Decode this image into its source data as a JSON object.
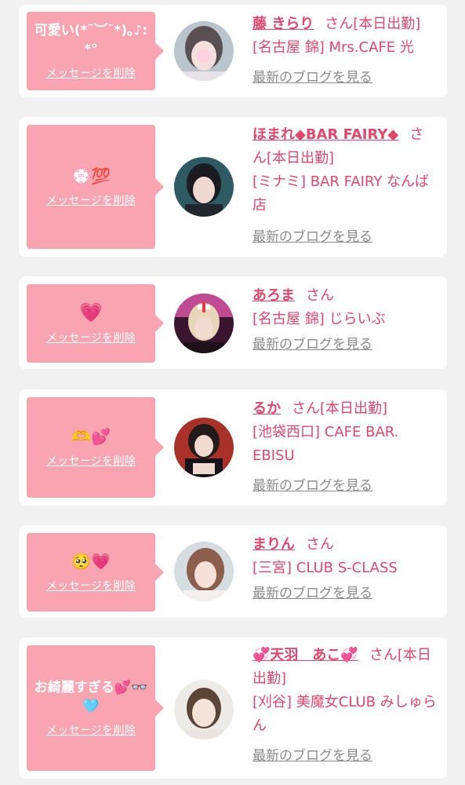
{
  "common": {
    "delete_label": "メッセージを削除",
    "blog_label": "最新のブログを見る"
  },
  "colors": {
    "background": "#f1f1f1",
    "bubble": "#f9a4b1",
    "accent": "#e0476e",
    "link_gray": "#8a8a8a"
  },
  "cards": [
    {
      "message": "可愛い(*¯︶¯*)｡♪:*°",
      "name": "藤 きらり",
      "honorific": "さん",
      "status": "[本日出勤]",
      "shop": "[名古屋 錦] Mrs.CAFE 光"
    },
    {
      "message": "💮💯",
      "name": "ほまれ◆BAR FAIRY◆",
      "honorific": "さん",
      "status": "[本日出勤]",
      "shop": "[ミナミ] BAR FAIRY なんば店"
    },
    {
      "message": "💗",
      "name": "あろま",
      "honorific": "さん",
      "status": "",
      "shop": "[名古屋 錦] じらいぶ"
    },
    {
      "message": "🫶💕",
      "name": "るか",
      "honorific": "さん",
      "status": "[本日出勤]",
      "shop": "[池袋西口] CAFE BAR. EBISU"
    },
    {
      "message": "🥺💗",
      "name": "まりん",
      "honorific": "さん",
      "status": "",
      "shop": "[三宮] CLUB S-CLASS"
    },
    {
      "message": "お綺麗すぎる💕👓🩵",
      "name": "💞天羽　あこ💞",
      "honorific": "さん",
      "status": "[本日出勤]",
      "shop": "[刈谷] 美魔女CLUB みしゅらん"
    }
  ]
}
